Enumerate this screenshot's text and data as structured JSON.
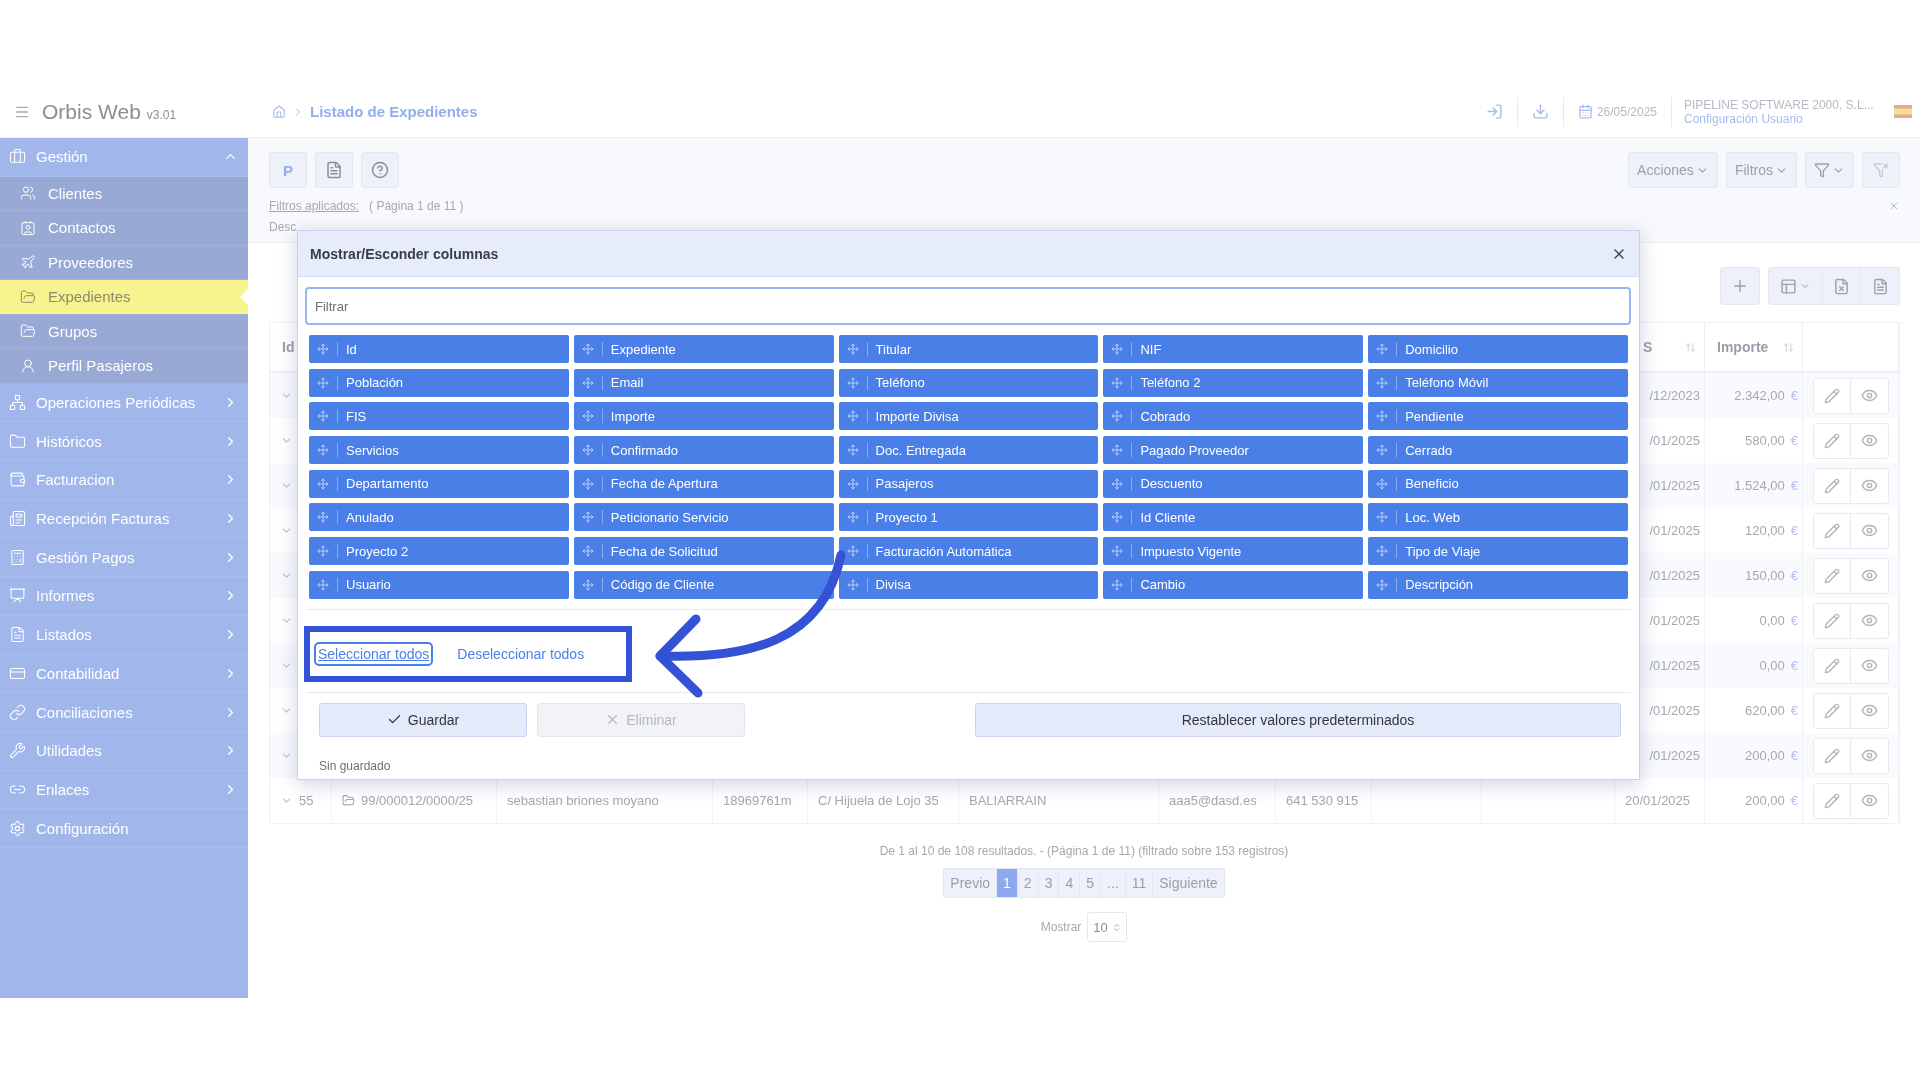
{
  "header": {
    "app_name": "Orbis Web",
    "version": "v3.01",
    "breadcrumb": "Listado de Expedientes",
    "date": "26/05/2025",
    "company": "PIPELINE SOFTWARE 2000, S.L...",
    "user_link": "Configuración Usuario"
  },
  "sidebar": {
    "items": [
      {
        "label": "Gestión",
        "kind": "group",
        "expanded": true,
        "children": [
          {
            "label": "Clientes",
            "selected": false
          },
          {
            "label": "Contactos",
            "selected": false
          },
          {
            "label": "Proveedores",
            "selected": false
          },
          {
            "label": "Expedientes",
            "selected": true
          },
          {
            "label": "Grupos",
            "selected": false
          },
          {
            "label": "Perfil Pasajeros",
            "selected": false
          }
        ]
      },
      {
        "label": "Operaciones Periódicas",
        "kind": "group",
        "expanded": false
      },
      {
        "label": "Históricos",
        "kind": "group",
        "expanded": false
      },
      {
        "label": "Facturacion",
        "kind": "group",
        "expanded": false
      },
      {
        "label": "Recepción Facturas",
        "kind": "group",
        "expanded": false
      },
      {
        "label": "Gestión Pagos",
        "kind": "group",
        "expanded": false
      },
      {
        "label": "Informes",
        "kind": "group",
        "expanded": false
      },
      {
        "label": "Listados",
        "kind": "group",
        "expanded": false
      },
      {
        "label": "Contabilidad",
        "kind": "group",
        "expanded": false
      },
      {
        "label": "Conciliaciones",
        "kind": "group",
        "expanded": false
      },
      {
        "label": "Utilidades",
        "kind": "group",
        "expanded": false
      },
      {
        "label": "Enlaces",
        "kind": "group",
        "expanded": false
      },
      {
        "label": "Configuración",
        "kind": "link"
      }
    ]
  },
  "toolbar": {
    "p_button": "P",
    "actions": "Acciones",
    "filters": "Filtros"
  },
  "filters": {
    "label": "Filtros aplicados:",
    "page": "( Página 1 de 11 )",
    "line_start": "Desc"
  },
  "table": {
    "columns": [
      {
        "label": "Id"
      },
      {
        "label": "S"
      },
      {
        "label": "Importe"
      }
    ],
    "rows": [
      {
        "kind": "covered",
        "date": "/12/2023",
        "amount": "2.342,00",
        "currency": "€"
      },
      {
        "kind": "covered",
        "date": "/01/2025",
        "amount": "580,00",
        "currency": "€"
      },
      {
        "kind": "covered",
        "date": "/01/2025",
        "amount": "1.524,00",
        "currency": "€"
      },
      {
        "kind": "covered",
        "date": "/01/2025",
        "amount": "120,00",
        "currency": "€"
      },
      {
        "kind": "covered",
        "date": "/01/2025",
        "amount": "150,00",
        "currency": "€"
      },
      {
        "kind": "covered",
        "date": "/01/2025",
        "amount": "0,00",
        "currency": "€"
      },
      {
        "kind": "covered",
        "date": "/01/2025",
        "amount": "0,00",
        "currency": "€"
      },
      {
        "kind": "covered",
        "date": "/01/2025",
        "amount": "620,00",
        "currency": "€"
      },
      {
        "kind": "covered",
        "date": "/01/2025",
        "amount": "200,00",
        "currency": "€"
      },
      {
        "kind": "full",
        "id": "55",
        "cells": [
          "99/000012/0000/25",
          "sebastian briones moyano",
          "18969761m",
          "C/ Hijuela de Lojo 35",
          "BALIARRAIN",
          "aaa5@dasd.es",
          "641 530 915"
        ],
        "date": "20/01/2025",
        "amount": "200,00",
        "currency": "€"
      }
    ]
  },
  "modal": {
    "title": "Mostrar/Esconder columnas",
    "filter_placeholder": "Filtrar",
    "columns": [
      {
        "label": "Id",
        "visible": true
      },
      {
        "label": "Expediente",
        "visible": true
      },
      {
        "label": "Titular",
        "visible": true
      },
      {
        "label": "NIF",
        "visible": true
      },
      {
        "label": "Domicilio",
        "visible": true
      },
      {
        "label": "Población",
        "visible": true
      },
      {
        "label": "Email",
        "visible": true
      },
      {
        "label": "Teléfono",
        "visible": true
      },
      {
        "label": "Teléfono 2",
        "visible": true
      },
      {
        "label": "Teléfono Móvil",
        "visible": true
      },
      {
        "label": "FIS",
        "visible": true
      },
      {
        "label": "Importe",
        "visible": true
      },
      {
        "label": "Importe Divisa",
        "visible": true
      },
      {
        "label": "Cobrado",
        "visible": true
      },
      {
        "label": "Pendiente",
        "visible": true
      },
      {
        "label": "Servicios",
        "visible": true
      },
      {
        "label": "Confirmado",
        "visible": true
      },
      {
        "label": "Doc. Entregada",
        "visible": true
      },
      {
        "label": "Pagado Proveedor",
        "visible": true
      },
      {
        "label": "Cerrado",
        "visible": true
      },
      {
        "label": "Departamento",
        "visible": true
      },
      {
        "label": "Fecha de Apertura",
        "visible": true
      },
      {
        "label": "Pasajeros",
        "visible": true
      },
      {
        "label": "Descuento",
        "visible": true
      },
      {
        "label": "Beneficio",
        "visible": true
      },
      {
        "label": "Anulado",
        "visible": true
      },
      {
        "label": "Peticionario Servicio",
        "visible": true
      },
      {
        "label": "Proyecto 1",
        "visible": true
      },
      {
        "label": "Id Cliente",
        "visible": true
      },
      {
        "label": "Loc. Web",
        "visible": true
      },
      {
        "label": "Proyecto 2",
        "visible": true
      },
      {
        "label": "Fecha de Solicitud",
        "visible": true
      },
      {
        "label": "Facturación Automática",
        "visible": true
      },
      {
        "label": "Impuesto Vigente",
        "visible": true
      },
      {
        "label": "Tipo de Viaje",
        "visible": true
      },
      {
        "label": "Usuario",
        "visible": true
      },
      {
        "label": "Código de Cliente",
        "visible": true
      },
      {
        "label": "Divisa",
        "visible": true
      },
      {
        "label": "Cambio",
        "visible": true
      },
      {
        "label": "Descripción",
        "visible": true
      }
    ],
    "select_all": {
      "label": "Seleccionar todos",
      "focused": true
    },
    "deselect_all": {
      "label": "Deseleccionar todos",
      "focused": false
    },
    "save": "Guardar",
    "delete": {
      "label": "Eliminar",
      "disabled": true
    },
    "reset": "Restablecer valores predeterminados",
    "status": "Sin guardado"
  },
  "footer": {
    "summary": "De 1 al 10 de 108 resultados. - (Página 1 de 11) (filtrado sobre 153 registros)",
    "pages": [
      {
        "label": "Previo",
        "selected": false
      },
      {
        "label": "1",
        "selected": true
      },
      {
        "label": "2",
        "selected": false
      },
      {
        "label": "3",
        "selected": false
      },
      {
        "label": "4",
        "selected": false
      },
      {
        "label": "5",
        "selected": false
      },
      {
        "label": "...",
        "selected": false
      },
      {
        "label": "11",
        "selected": false
      },
      {
        "label": "Siguiente",
        "selected": false
      }
    ],
    "show_label": "Mostrar",
    "page_size": "10"
  }
}
